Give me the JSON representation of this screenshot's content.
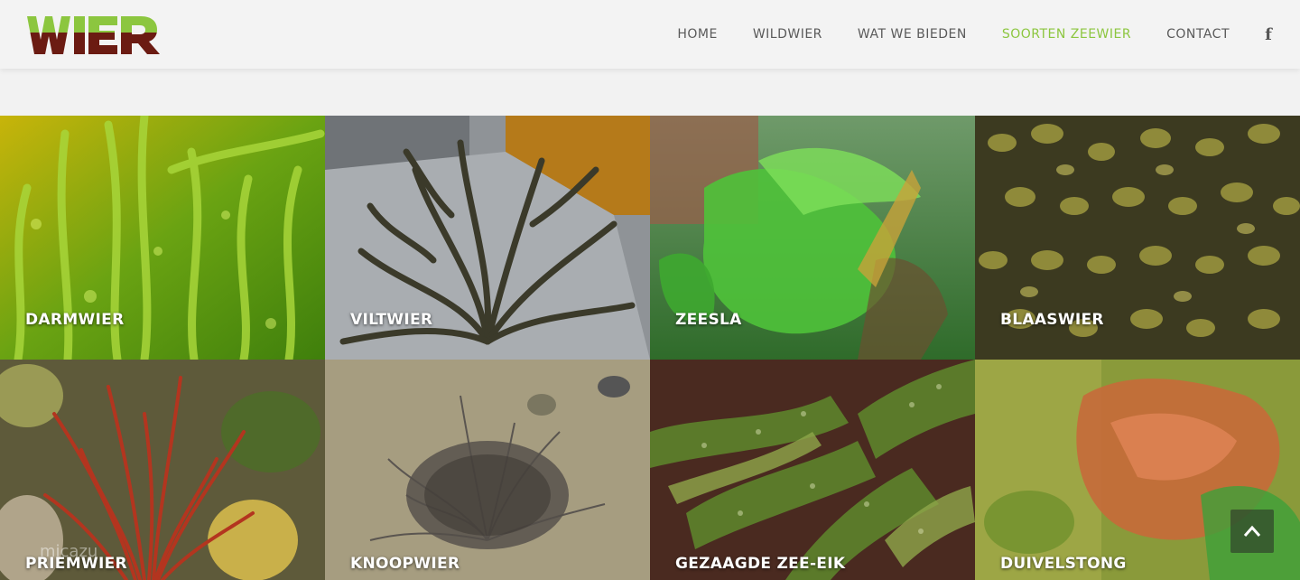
{
  "brand": {
    "logo_text": "WIER",
    "accent": "#8cc63f",
    "logo_dark": "#6b1b12"
  },
  "nav": {
    "items": [
      {
        "label": "HOME",
        "active": false
      },
      {
        "label": "WILDWIER",
        "active": false
      },
      {
        "label": "WAT WE BIEDEN",
        "active": false
      },
      {
        "label": "SOORTEN ZEEWIER",
        "active": true
      },
      {
        "label": "CONTACT",
        "active": false
      }
    ],
    "social_icon": "facebook-icon"
  },
  "tiles": [
    {
      "label": "DARMWIER"
    },
    {
      "label": "VILTWIER"
    },
    {
      "label": "ZEESLA"
    },
    {
      "label": "BLAASWIER"
    },
    {
      "label": "PRIEMWIER"
    },
    {
      "label": "KNOOPWIER"
    },
    {
      "label": "GEZAAGDE ZEE-EIK"
    },
    {
      "label": "DUIVELSTONG"
    }
  ],
  "watermark": "micazu",
  "back_to_top_icon": "chevron-up-icon"
}
